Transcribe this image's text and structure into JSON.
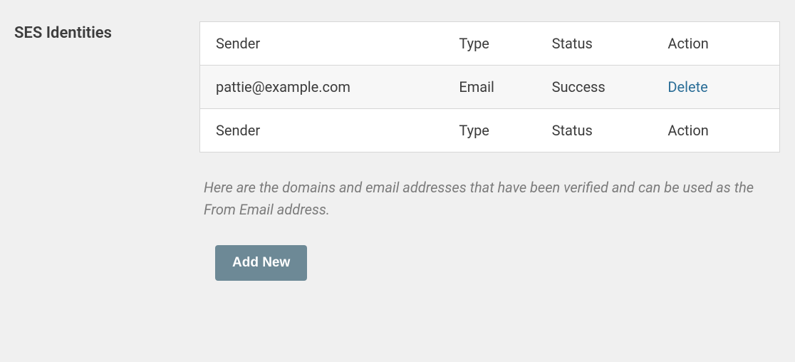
{
  "section": {
    "title": "SES Identities",
    "help_text": "Here are the domains and email addresses that have been verified and can be used as the From Email address.",
    "add_button_label": "Add New"
  },
  "table": {
    "headers": {
      "sender": "Sender",
      "type": "Type",
      "status": "Status",
      "action": "Action"
    },
    "rows": [
      {
        "sender": "pattie@example.com",
        "type": "Email",
        "status": "Success",
        "action_label": "Delete"
      }
    ]
  }
}
